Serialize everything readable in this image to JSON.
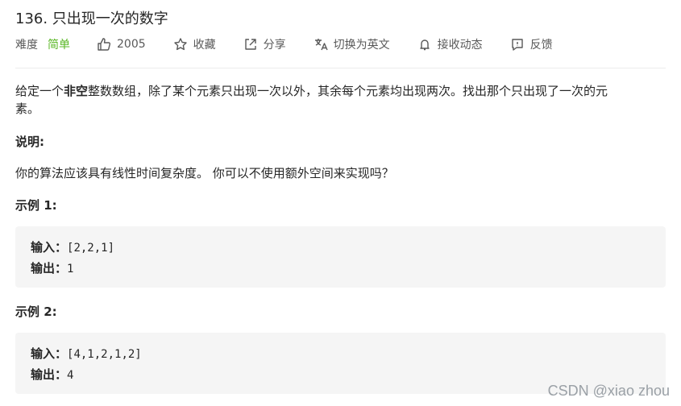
{
  "problem": {
    "title": "136. 只出现一次的数字"
  },
  "meta": {
    "difficulty_label": "难度",
    "difficulty_value": "简单",
    "likes": "2005",
    "favorite": "收藏",
    "share": "分享",
    "switch_lang": "切换为英文",
    "notify": "接收动态",
    "feedback": "反馈",
    "colors": {
      "easy": "#5ab726"
    }
  },
  "description": {
    "line_prefix": "给定一个",
    "bold_word": "非空",
    "line_rest": "整数数组，除了某个元素只出现一次以外，其余每个元素均出现两次。找出那个只出现了一次的元",
    "line_wrap": "素。"
  },
  "note": {
    "heading": "说明:",
    "text": "你的算法应该具有线性时间复杂度。 你可以不使用额外空间来实现吗？"
  },
  "examples": [
    {
      "heading": "示例 1:",
      "input_label": "输入：",
      "input_value": "[2,2,1]",
      "output_label": "输出：",
      "output_value": "1"
    },
    {
      "heading": "示例 2:",
      "input_label": "输入：",
      "input_value": "[4,1,2,1,2]",
      "output_label": "输出：",
      "output_value": "4"
    }
  ],
  "watermark": "CSDN @xiao  zhou"
}
